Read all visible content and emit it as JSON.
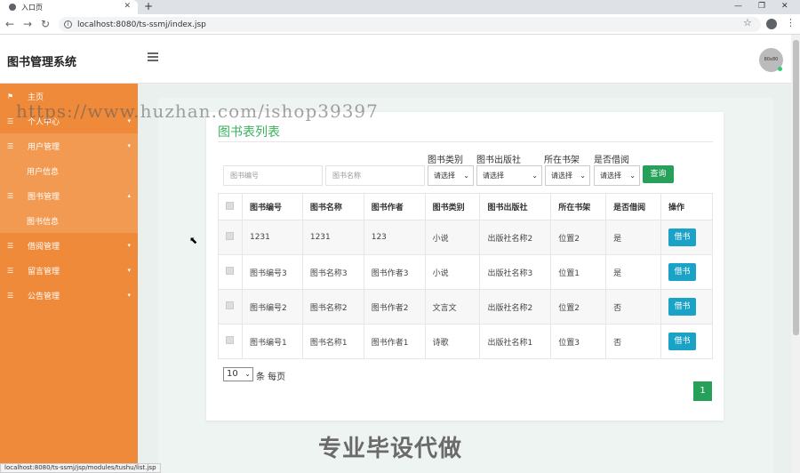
{
  "browser": {
    "tab_title": "入口页",
    "url": "localhost:8080/ts-ssmj/index.jsp",
    "status_url": "localhost:8080/ts-ssmj/jsp/modules/tushu/list.jsp"
  },
  "header": {
    "brand": "图书管理系统",
    "avatar_text": "80x80"
  },
  "sidebar": {
    "items": [
      {
        "label": "主页"
      },
      {
        "label": "个人中心"
      },
      {
        "label": "用户管理"
      },
      {
        "label": "用户信息"
      },
      {
        "label": "图书管理"
      },
      {
        "label": "图书信息"
      },
      {
        "label": "借阅管理"
      },
      {
        "label": "留言管理"
      },
      {
        "label": "公告管理"
      }
    ]
  },
  "panel": {
    "title": "图书表列表",
    "filters": {
      "book_no_placeholder": "图书编号",
      "book_name_placeholder": "图书名称",
      "category_label": "图书类别",
      "publisher_label": "图书出版社",
      "shelf_label": "所在书架",
      "borrowed_label": "是否借阅",
      "select_placeholder": "请选择",
      "query_button": "查询"
    },
    "table": {
      "headers": [
        "图书编号",
        "图书名称",
        "图书作者",
        "图书类别",
        "图书出版社",
        "所在书架",
        "是否借阅",
        "操作"
      ],
      "rows": [
        [
          "1231",
          "1231",
          "123",
          "小说",
          "出版社名称2",
          "位置2",
          "是"
        ],
        [
          "图书编号3",
          "图书名称3",
          "图书作者3",
          "小说",
          "出版社名称3",
          "位置1",
          "是"
        ],
        [
          "图书编号2",
          "图书名称2",
          "图书作者2",
          "文言文",
          "出版社名称2",
          "位置2",
          "否"
        ],
        [
          "图书编号1",
          "图书名称1",
          "图书作者1",
          "诗歌",
          "出版社名称1",
          "位置3",
          "否"
        ]
      ],
      "action_label": "借书"
    },
    "pagination": {
      "page_size": "10",
      "per_page_text": "条 每页",
      "current_page": "1"
    }
  },
  "watermarks": {
    "url_text": "https://www.huzhan.com/ishop39397",
    "slogan": "专业毕设代做"
  }
}
